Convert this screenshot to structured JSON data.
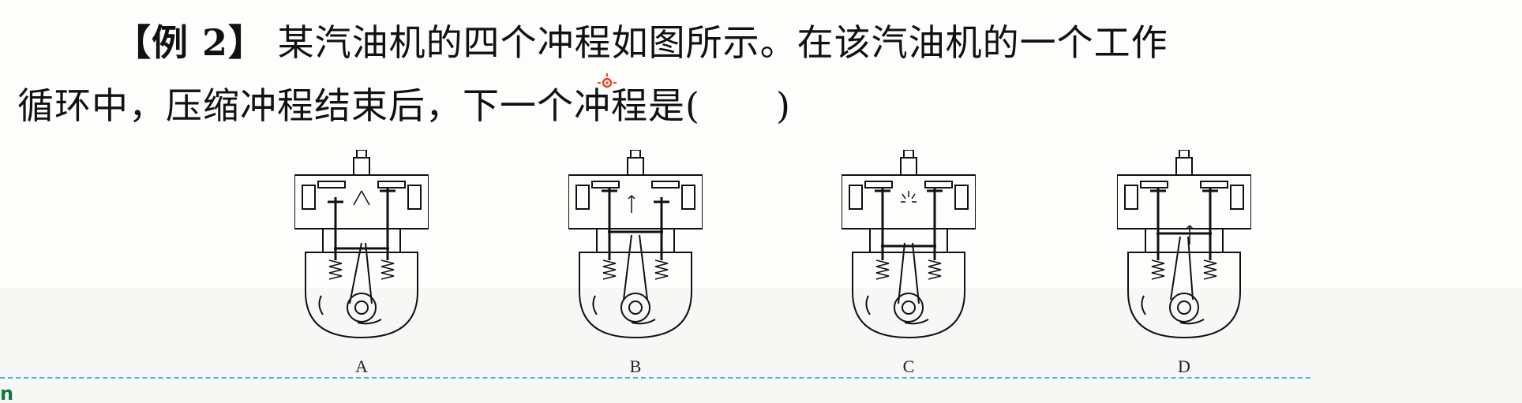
{
  "question": {
    "tag": "【例 2】",
    "line1": "某汽油机的四个冲程如图所示。在该汽油机的一个工作",
    "line2_text": "循环中，压缩冲程结束后，下一个冲程是(",
    "line2_close": ")"
  },
  "options": [
    {
      "label": "A",
      "stroke": "intake"
    },
    {
      "label": "B",
      "stroke": "exhaust"
    },
    {
      "label": "C",
      "stroke": "power"
    },
    {
      "label": "D",
      "stroke": "compression"
    }
  ],
  "corner_text": "n",
  "colors": {
    "divider": "#3fb6d6",
    "cursor": "#e8401c",
    "corner": "#0f7a3a"
  }
}
